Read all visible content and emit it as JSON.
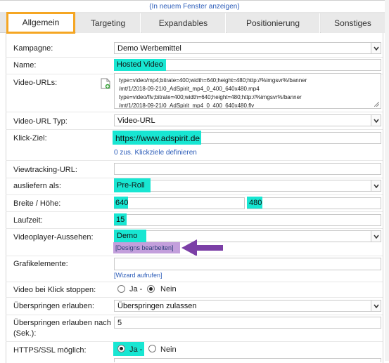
{
  "toplink": {
    "open_new_window": "In neuem Fenster anzeigen",
    "paren_open": "(",
    "paren_close": ")"
  },
  "tabs": [
    {
      "label": "Allgemein",
      "active": true
    },
    {
      "label": "Targeting",
      "active": false
    },
    {
      "label": "Expandables",
      "active": false
    },
    {
      "label": "Positionierung",
      "active": false
    },
    {
      "label": "Sonstiges",
      "active": false
    }
  ],
  "form": {
    "kampagne": {
      "label": "Kampagne:",
      "value": "Demo Werbemittel"
    },
    "name": {
      "label": "Name:",
      "value": "Hosted Video"
    },
    "video_urls": {
      "label": "Video-URLs:",
      "lines": [
        "type=video/mp4;bitrate=400;width=640;height=480;http://%imgsvr%/banner",
        "/mt/1/2018-09-21/0_AdSpirit_mp4_0_400_640x480.mp4",
        "type=video/flv;bitrate=400;width=640;height=480;http://%imgsvr%/banner",
        "/mt/1/2018-09-21/0_AdSpirit_mp4_0_400_640x480.flv"
      ]
    },
    "video_url_typ": {
      "label": "Video-URL Typ:",
      "value": "Video-URL"
    },
    "klick_ziel": {
      "label": "Klick-Ziel:",
      "value": "https://www.adspirit.de",
      "more_link": "0 zus. Klickziele definieren"
    },
    "viewtracking": {
      "label": "Viewtracking-URL:",
      "value": ""
    },
    "ausliefern": {
      "label": "ausliefern als:",
      "value": "Pre-Roll"
    },
    "breite_hoehe": {
      "label": "Breite / Höhe:",
      "width": "640",
      "height": "480"
    },
    "laufzeit": {
      "label": "Laufzeit:",
      "value": "15"
    },
    "player_aussehen": {
      "label": "Videoplayer-Aussehen:",
      "value": "Demo",
      "edit_link": "[Designs bearbeiten]"
    },
    "grafikelemente": {
      "label": "Grafikelemente:",
      "value": "",
      "wizard_link": "[Wizard aufrufen]"
    },
    "stop_on_click": {
      "label": "Video bei Klick stoppen:",
      "yes": "Ja -",
      "no": "Nein",
      "selected": "no"
    },
    "skip_allowed": {
      "label": "Überspringen erlauben:",
      "value": "Überspringen zulassen"
    },
    "skip_after": {
      "label_line1": "Überspringen erlauben nach",
      "label_line2": "(Sek.):",
      "value": "5"
    },
    "https_ssl": {
      "label": "HTTPS/SSL möglich:",
      "yes": "Ja -",
      "no": "Nein",
      "selected": "yes"
    }
  },
  "colors": {
    "highlight": "#18e6d2",
    "active_tab_border": "#f5a623",
    "link": "#2a5bb8",
    "annotation_arrow": "#7b3fa6"
  },
  "icons": {
    "add_url": "document-add-icon",
    "select": "chevron-down-icon",
    "annotation": "arrow-left-icon"
  }
}
